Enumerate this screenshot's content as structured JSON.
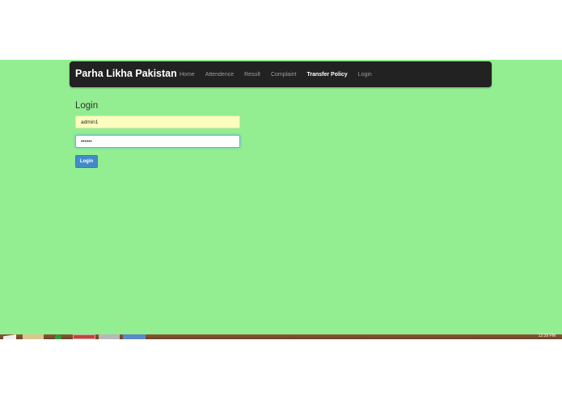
{
  "navbar": {
    "brand": "Parha Likha Pakistan",
    "links": [
      {
        "label": "Home",
        "active": false
      },
      {
        "label": "Attendence",
        "active": false
      },
      {
        "label": "Result",
        "active": false
      },
      {
        "label": "Complaint",
        "active": false
      },
      {
        "label": "Transfer Policy",
        "active": true
      },
      {
        "label": "Login",
        "active": false
      }
    ]
  },
  "login": {
    "title": "Login",
    "username_value": "admin1",
    "password_value": "••••••",
    "button_label": "Login"
  },
  "taskbar": {
    "clock": "12:39 PM"
  },
  "colors": {
    "page_bg": "#92ee90",
    "navbar_bg": "#222222",
    "button_bg": "#428bca",
    "autofill_bg": "#fcfcbf"
  }
}
